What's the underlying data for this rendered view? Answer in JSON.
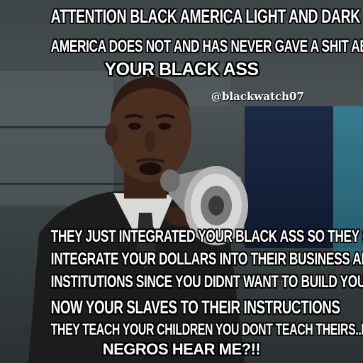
{
  "top_text": {
    "line1": "ATTENTION BLACK AMERICA LIGHT AND DARK SKIN",
    "line2": "AMERICA DOES NOT AND HAS NEVER GAVE A SHIT ABOUT",
    "line3": "YOUR BLACK ASS"
  },
  "watermark": "@blackwatch07",
  "bottom_text": {
    "line1": "THEY JUST INTEGRATED YOUR BLACK ASS SO THEY COULD",
    "line2": "INTEGRATE YOUR DOLLARS INTO THEIR BUSINESS AND",
    "line3": "INSTITUTIONS SINCE YOU DIDNT WANT TO BUILD YOUR OWN",
    "line4": "NOW YOUR SLAVES TO THEIR INSTRUCTIONS",
    "line5": "THEY TEACH YOUR CHILDREN YOU DONT TEACH THEIRS..DO YOU",
    "line6": "NEGROS HEAR ME?!!"
  },
  "photo": {
    "subject": "man-with-megaphone-icon"
  }
}
